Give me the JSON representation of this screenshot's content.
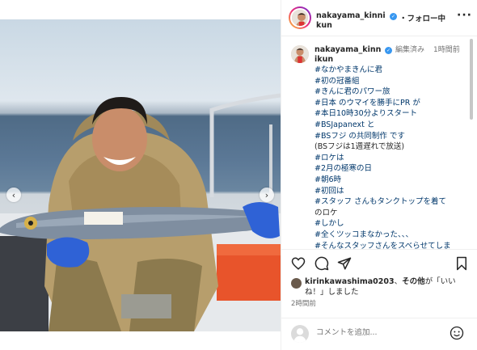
{
  "header": {
    "username": "nakayama_kinnikun",
    "follow_label": "・フォロー中",
    "more_label": "···"
  },
  "caption": {
    "username": "nakayama_kinnikun",
    "edited_label": "編集済み",
    "time": "1時間前",
    "lines": [
      {
        "text": "#なかやまきんに君",
        "tag": true
      },
      {
        "text": "#初の冠番組",
        "tag": true
      },
      {
        "text": "#きんに君のパワー旅",
        "tag": true
      },
      {
        "text": "#日本 のウマイを勝手にPR が",
        "tag": true
      },
      {
        "text": "#本日10時30分よりスタート",
        "tag": true
      },
      {
        "text": "#BSJapanext と",
        "tag": true
      },
      {
        "text": "#BSフジ の共同制作 です",
        "tag": true
      },
      {
        "text": "(BSフジは1週遅れで放送)",
        "tag": false
      },
      {
        "text": "#ロケは",
        "tag": true
      },
      {
        "text": "#2月の極寒の日",
        "tag": true
      },
      {
        "text": "#朝6時",
        "tag": true
      },
      {
        "text": "#初回は",
        "tag": true
      },
      {
        "text": "#スタッフ さんもタンクトップを着て",
        "tag": true
      },
      {
        "text": "のロケ",
        "tag": false
      },
      {
        "text": "#しかし",
        "tag": true
      },
      {
        "text": "#全くツッコまなかった、、、",
        "tag": true
      },
      {
        "text": "#そんなスタッフさんをスベらせてしま",
        "tag": true
      }
    ]
  },
  "likes": {
    "user": "kirinkawashima0203",
    "others": "その他",
    "text_mid": "、",
    "text_end": "が「いいね！」しました"
  },
  "posted_time": "2時間前",
  "comment": {
    "placeholder": "コメントを追加..."
  },
  "icons": {
    "like": "heart-icon",
    "comment": "comment-icon",
    "share": "paper-plane-icon",
    "save": "bookmark-icon",
    "emoji": "smiley-icon",
    "prev": "chevron-left-icon",
    "next": "chevron-right-icon"
  },
  "colors": {
    "verified": "#3897f0",
    "hashtag": "#00376b",
    "secondary_text": "#737373"
  }
}
